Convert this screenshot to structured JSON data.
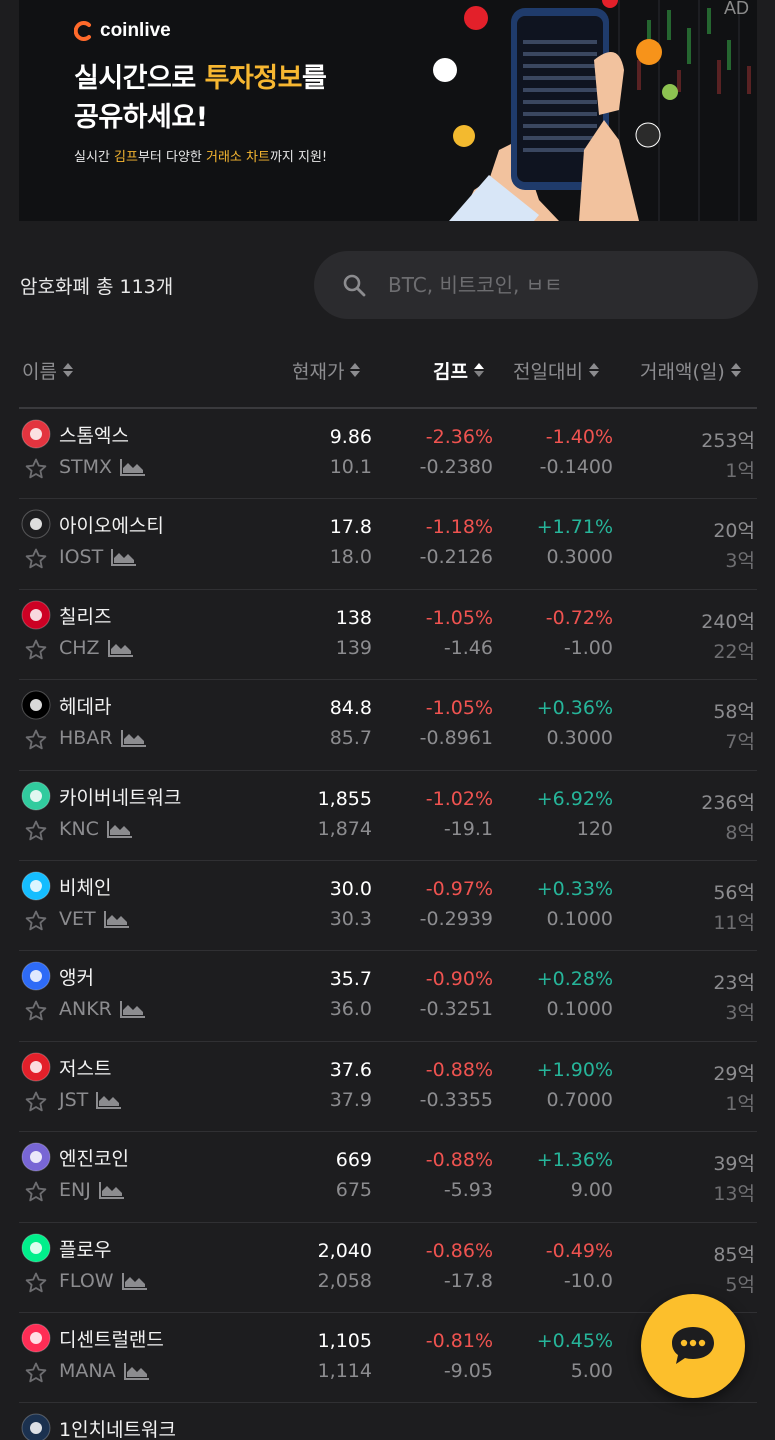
{
  "banner": {
    "ad_label": "AD",
    "brand": "coinlive",
    "headline_1a": "실시간으로 ",
    "headline_1b": "투자정보",
    "headline_1c": "를",
    "headline_2": "공유하세요!",
    "sub_a": "실시간 ",
    "sub_b": "김프",
    "sub_c": "부터 다양한 ",
    "sub_d": "거래소 차트",
    "sub_e": "까지 지원!"
  },
  "summary": {
    "count_label": "암호화폐 총 113개"
  },
  "search": {
    "placeholder": "BTC, 비트코인, ㅂㅌ",
    "value": ""
  },
  "columns": {
    "name": "이름",
    "price": "현재가",
    "kimp": "김프",
    "change": "전일대비",
    "volume": "거래액(일)"
  },
  "coins": [
    {
      "name": "스톰엑스",
      "symbol": "STMX",
      "price": "9.86",
      "price2": "10.1",
      "kimp": "-2.36%",
      "kimp2": "-0.2380",
      "change": "-1.40%",
      "change2": "-0.1400",
      "change_dir": "neg",
      "vol": "253억",
      "vol2": "1억",
      "icon_color": "#e3343f"
    },
    {
      "name": "아이오에스티",
      "symbol": "IOST",
      "price": "17.8",
      "price2": "18.0",
      "kimp": "-1.18%",
      "kimp2": "-0.2126",
      "change": "+1.71%",
      "change2": "0.3000",
      "change_dir": "pos",
      "vol": "20억",
      "vol2": "3억",
      "icon_color": "#1d1d1f"
    },
    {
      "name": "칠리즈",
      "symbol": "CHZ",
      "price": "138",
      "price2": "139",
      "kimp": "-1.05%",
      "kimp2": "-1.46",
      "change": "-0.72%",
      "change2": "-1.00",
      "change_dir": "neg",
      "vol": "240억",
      "vol2": "22억",
      "icon_color": "#cd0124"
    },
    {
      "name": "헤데라",
      "symbol": "HBAR",
      "price": "84.8",
      "price2": "85.7",
      "kimp": "-1.05%",
      "kimp2": "-0.8961",
      "change": "+0.36%",
      "change2": "0.3000",
      "change_dir": "pos",
      "vol": "58억",
      "vol2": "7억",
      "icon_color": "#000000"
    },
    {
      "name": "카이버네트워크",
      "symbol": "KNC",
      "price": "1,855",
      "price2": "1,874",
      "kimp": "-1.02%",
      "kimp2": "-19.1",
      "change": "+6.92%",
      "change2": "120",
      "change_dir": "pos",
      "vol": "236억",
      "vol2": "8억",
      "icon_color": "#31cb9e"
    },
    {
      "name": "비체인",
      "symbol": "VET",
      "price": "30.0",
      "price2": "30.3",
      "kimp": "-0.97%",
      "kimp2": "-0.2939",
      "change": "+0.33%",
      "change2": "0.1000",
      "change_dir": "pos",
      "vol": "56억",
      "vol2": "11억",
      "icon_color": "#15bdff"
    },
    {
      "name": "앵커",
      "symbol": "ANKR",
      "price": "35.7",
      "price2": "36.0",
      "kimp": "-0.90%",
      "kimp2": "-0.3251",
      "change": "+0.28%",
      "change2": "0.1000",
      "change_dir": "pos",
      "vol": "23억",
      "vol2": "3억",
      "icon_color": "#2e6bf6"
    },
    {
      "name": "저스트",
      "symbol": "JST",
      "price": "37.6",
      "price2": "37.9",
      "kimp": "-0.88%",
      "kimp2": "-0.3355",
      "change": "+1.90%",
      "change2": "0.7000",
      "change_dir": "pos",
      "vol": "29억",
      "vol2": "1억",
      "icon_color": "#e3202a"
    },
    {
      "name": "엔진코인",
      "symbol": "ENJ",
      "price": "669",
      "price2": "675",
      "kimp": "-0.88%",
      "kimp2": "-5.93",
      "change": "+1.36%",
      "change2": "9.00",
      "change_dir": "pos",
      "vol": "39억",
      "vol2": "13억",
      "icon_color": "#7866d5"
    },
    {
      "name": "플로우",
      "symbol": "FLOW",
      "price": "2,040",
      "price2": "2,058",
      "kimp": "-0.86%",
      "kimp2": "-17.8",
      "change": "-0.49%",
      "change2": "-10.0",
      "change_dir": "neg",
      "vol": "85억",
      "vol2": "5억",
      "icon_color": "#00ef8b"
    },
    {
      "name": "디센트럴랜드",
      "symbol": "MANA",
      "price": "1,105",
      "price2": "1,114",
      "kimp": "-0.81%",
      "kimp2": "-9.05",
      "change": "+0.45%",
      "change2": "5.00",
      "change_dir": "pos",
      "vol": "",
      "vol2": "",
      "icon_color": "#ff2d55"
    },
    {
      "name": "1인치네트워크",
      "symbol": "",
      "price": "",
      "price2": "",
      "kimp": "",
      "kimp2": "",
      "change": "",
      "change2": "",
      "change_dir": "pos",
      "vol": "",
      "vol2": "",
      "icon_color": "#1b314f"
    }
  ],
  "colors": {
    "background": "#1d1d1f",
    "accent": "#f7b731",
    "negative": "#ef5350",
    "positive": "#26b59a",
    "chat_button": "#fcbf2c"
  },
  "icons": {
    "search": "search-icon",
    "star": "star-outline-icon",
    "chart": "area-chart-icon",
    "chat": "chat-bubble-icon"
  }
}
